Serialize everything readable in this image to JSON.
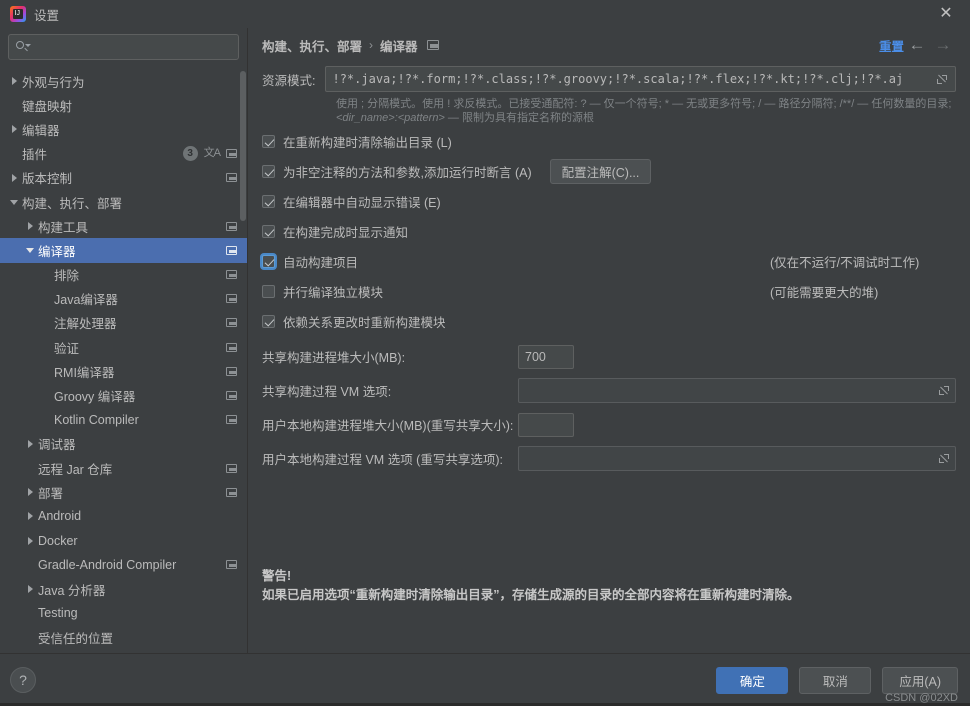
{
  "window": {
    "title": "设置",
    "close_label": "✕",
    "app_icon": "intellij-idea-logo"
  },
  "sidebar": {
    "search": {
      "value": "",
      "placeholder": ""
    },
    "items": [
      {
        "label": "外观与行为",
        "indent": 0,
        "arrow": "collapsed",
        "icons": []
      },
      {
        "label": "键盘映射",
        "indent": 0,
        "arrow": "none",
        "icons": []
      },
      {
        "label": "编辑器",
        "indent": 0,
        "arrow": "collapsed",
        "icons": []
      },
      {
        "label": "插件",
        "indent": 0,
        "arrow": "none",
        "icons": [
          "badge-3",
          "translate",
          "list"
        ],
        "badge": "3"
      },
      {
        "label": "版本控制",
        "indent": 0,
        "arrow": "collapsed",
        "icons": [
          "list"
        ]
      },
      {
        "label": "构建、执行、部署",
        "indent": 0,
        "arrow": "expanded",
        "icons": []
      },
      {
        "label": "构建工具",
        "indent": 1,
        "arrow": "collapsed",
        "icons": [
          "list"
        ]
      },
      {
        "label": "编译器",
        "indent": 1,
        "arrow": "expanded",
        "icons": [
          "list"
        ],
        "selected": true
      },
      {
        "label": "排除",
        "indent": 2,
        "arrow": "none",
        "icons": [
          "list"
        ]
      },
      {
        "label": "Java编译器",
        "indent": 2,
        "arrow": "none",
        "icons": [
          "list"
        ]
      },
      {
        "label": "注解处理器",
        "indent": 2,
        "arrow": "none",
        "icons": [
          "list"
        ]
      },
      {
        "label": "验证",
        "indent": 2,
        "arrow": "none",
        "icons": [
          "list"
        ]
      },
      {
        "label": "RMI编译器",
        "indent": 2,
        "arrow": "none",
        "icons": [
          "list"
        ]
      },
      {
        "label": "Groovy 编译器",
        "indent": 2,
        "arrow": "none",
        "icons": [
          "list"
        ]
      },
      {
        "label": "Kotlin Compiler",
        "indent": 2,
        "arrow": "none",
        "icons": [
          "list"
        ]
      },
      {
        "label": "调试器",
        "indent": 1,
        "arrow": "collapsed",
        "icons": []
      },
      {
        "label": "远程 Jar 仓库",
        "indent": 1,
        "arrow": "none",
        "icons": [
          "list"
        ]
      },
      {
        "label": "部署",
        "indent": 1,
        "arrow": "collapsed",
        "icons": [
          "list"
        ]
      },
      {
        "label": "Android",
        "indent": 1,
        "arrow": "collapsed",
        "icons": []
      },
      {
        "label": "Docker",
        "indent": 1,
        "arrow": "collapsed",
        "icons": []
      },
      {
        "label": "Gradle-Android Compiler",
        "indent": 1,
        "arrow": "none",
        "icons": [
          "list"
        ]
      },
      {
        "label": "Java 分析器",
        "indent": 1,
        "arrow": "collapsed",
        "icons": []
      },
      {
        "label": "Testing",
        "indent": 1,
        "arrow": "none",
        "icons": []
      },
      {
        "label": "受信任的位置",
        "indent": 1,
        "arrow": "none",
        "icons": []
      }
    ]
  },
  "breadcrumb": {
    "parent": "构建、执行、部署",
    "separator": "›",
    "current": "编译器",
    "reset_label": "重置",
    "back_arrow": "←",
    "forward_arrow": "→"
  },
  "main": {
    "pattern": {
      "label": "资源模式:",
      "value": "!?*.java;!?*.form;!?*.class;!?*.groovy;!?*.scala;!?*.flex;!?*.kt;!?*.clj;!?*.aj",
      "placeholder": "",
      "hint_line1": "使用 ; 分隔模式。使用 ! 求反模式。已接受通配符: ? — 仅一个符号; * — 无或更多符号; / — 路径分隔符; /**/ — 任何数量的目录;",
      "hint_line2_italic": "<dir_name>:<pattern>",
      "hint_line2_rest": " — 限制为具有指定名称的源根"
    },
    "checkboxes": [
      {
        "label": "在重新构建时清除输出目录 (L)",
        "checked": true,
        "focused": false,
        "note": "",
        "button": ""
      },
      {
        "label": "为非空注释的方法和参数,添加运行时断言 (A)",
        "checked": true,
        "focused": false,
        "note": "",
        "button": "配置注解(C)..."
      },
      {
        "label": "在编辑器中自动显示错误 (E)",
        "checked": true,
        "focused": false,
        "note": "",
        "button": ""
      },
      {
        "label": "在构建完成时显示通知",
        "checked": true,
        "focused": false,
        "note": "",
        "button": ""
      },
      {
        "label": "自动构建项目",
        "checked": true,
        "focused": true,
        "note": "(仅在不运行/不调试时工作)",
        "button": ""
      },
      {
        "label": "并行编译独立模块",
        "checked": false,
        "focused": false,
        "note": "(可能需要更大的堆)",
        "button": ""
      },
      {
        "label": "依赖关系更改时重新构建模块",
        "checked": true,
        "focused": false,
        "note": "",
        "button": ""
      }
    ],
    "fields": [
      {
        "label": "共享构建进程堆大小(MB):",
        "value": "700",
        "type": "number",
        "placeholder": ""
      },
      {
        "label": "共享构建过程 VM 选项:",
        "value": "",
        "type": "vm",
        "placeholder": ""
      },
      {
        "label": "用户本地构建进程堆大小(MB)(重写共享大小):",
        "value": "",
        "type": "number",
        "placeholder": ""
      },
      {
        "label": "用户本地构建过程 VM 选项 (重写共享选项):",
        "value": "",
        "type": "vm",
        "placeholder": ""
      }
    ],
    "warning_title": "警告!",
    "warning_text": "如果已启用选项“重新构建时清除输出目录”，存储生成源的目录的全部内容将在重新构建时清除。"
  },
  "footer": {
    "help_label": "?",
    "ok_label": "确定",
    "cancel_label": "取消",
    "apply_label": "应用(A)",
    "watermark": "CSDN @02XD"
  },
  "colors": {
    "accent_blue": "#4b6eaf",
    "link_blue": "#4b8ee8",
    "primary_button": "#4071b5",
    "panel_bg": "#3c3f41",
    "field_bg": "#45494a",
    "text": "#bbbbbb"
  }
}
